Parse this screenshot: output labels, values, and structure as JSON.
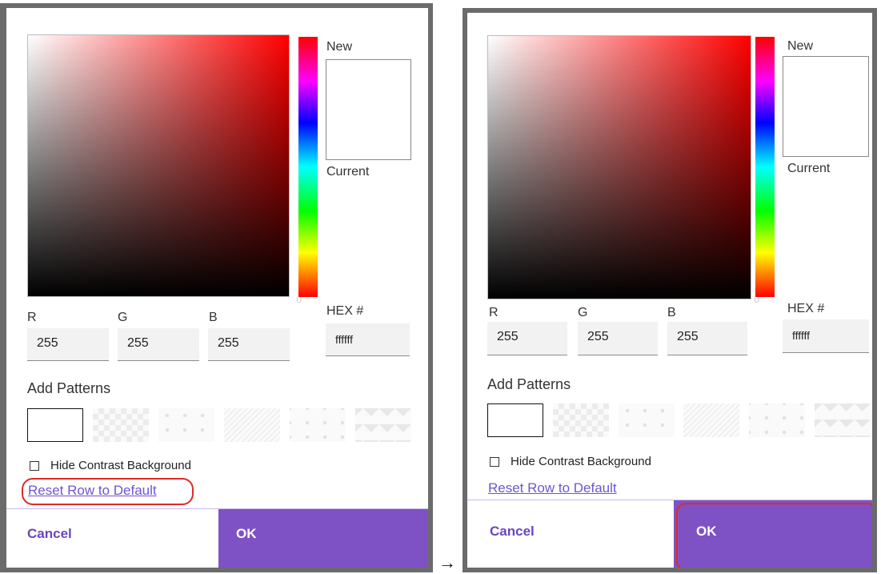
{
  "transition_arrow": "→",
  "panels": [
    {
      "color_preview": {
        "new_label": "New",
        "current_label": "Current"
      },
      "rgb": {
        "r_label": "R",
        "g_label": "G",
        "b_label": "B",
        "r_value": "255",
        "g_value": "255",
        "b_value": "255"
      },
      "hex": {
        "label": "HEX #",
        "value": "ffffff"
      },
      "hue_marker": "U",
      "patterns": {
        "title": "Add Patterns",
        "options": [
          "none",
          "checkerboard",
          "dots",
          "diagonal-stripes",
          "dots-offset",
          "zigzag"
        ],
        "selected": "none"
      },
      "hide_contrast": {
        "label": "Hide Contrast Background",
        "checked": false
      },
      "reset_link": "Reset Row to Default",
      "buttons": {
        "cancel": "Cancel",
        "ok": "OK"
      },
      "highlight_color": "#e02a2a"
    },
    {
      "color_preview": {
        "new_label": "New",
        "current_label": "Current"
      },
      "rgb": {
        "r_label": "R",
        "g_label": "G",
        "b_label": "B",
        "r_value": "255",
        "g_value": "255",
        "b_value": "255"
      },
      "hex": {
        "label": "HEX #",
        "value": "ffffff"
      },
      "hue_marker": "U",
      "patterns": {
        "title": "Add Patterns",
        "options": [
          "none",
          "checkerboard",
          "dots",
          "diagonal-stripes",
          "dots-offset",
          "zigzag"
        ],
        "selected": "none"
      },
      "hide_contrast": {
        "label": "Hide Contrast Background",
        "checked": false
      },
      "reset_link": "Reset Row to Default",
      "buttons": {
        "cancel": "Cancel",
        "ok": "OK"
      },
      "highlight_color": "#e02a2a"
    }
  ],
  "colors": {
    "accent": "#7e52c4",
    "link": "#6e55d4",
    "highlight": "#e02a2a"
  }
}
